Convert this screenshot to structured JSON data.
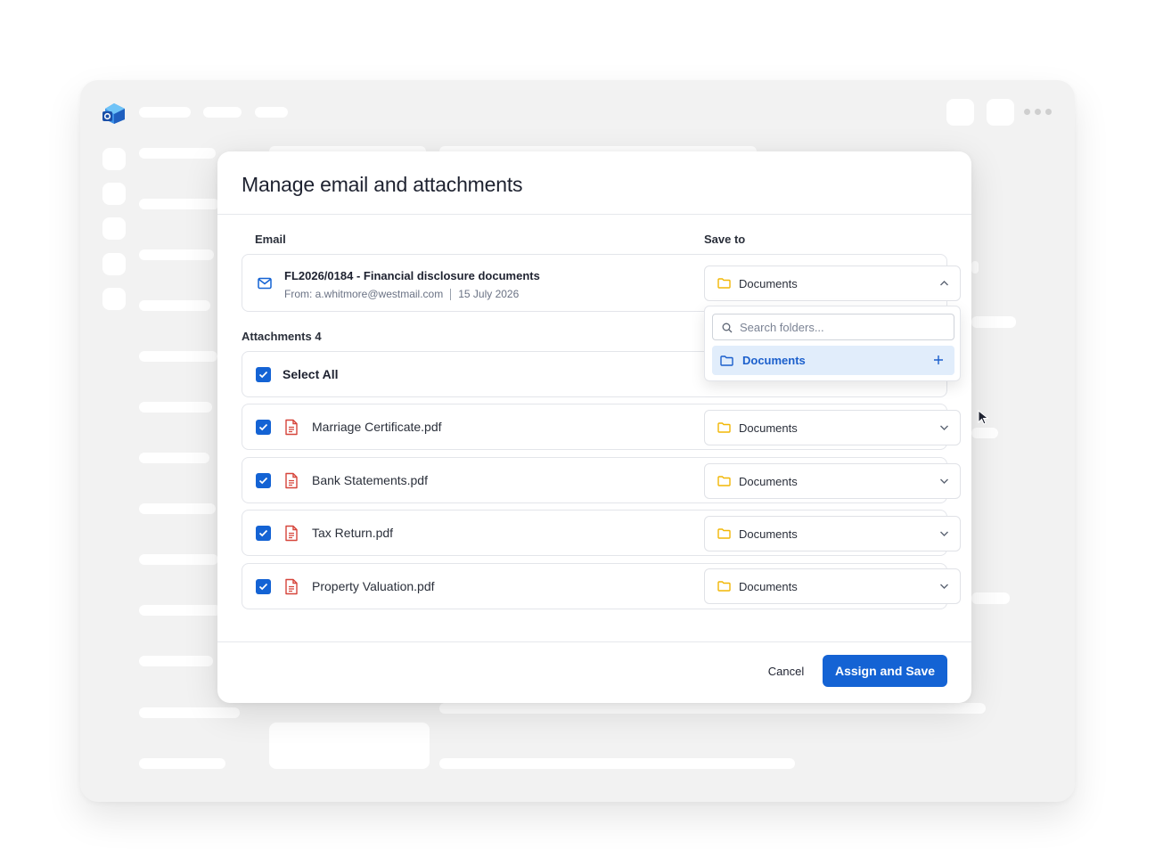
{
  "modal": {
    "title": "Manage email and attachments",
    "email_column_label": "Email",
    "save_to_column_label": "Save to",
    "email": {
      "subject": "FL2026/0184 - Financial disclosure documents",
      "from": "From: a.whitmore@westmail.com",
      "date": "15 July 2026",
      "save_to": "Documents",
      "icon": "mail-icon"
    },
    "attachments_label": "Attachments 4",
    "select_all": {
      "label": "Select All",
      "checked": true
    },
    "attachments": [
      {
        "name": "Marriage Certificate.pdf",
        "save_to": "Documents",
        "checked": true
      },
      {
        "name": "Bank Statements.pdf",
        "save_to": "Documents",
        "checked": true
      },
      {
        "name": "Tax Return.pdf",
        "save_to": "Documents",
        "checked": true
      },
      {
        "name": "Property Valuation.pdf",
        "save_to": "Documents",
        "checked": true
      }
    ],
    "dropdown": {
      "open": true,
      "search_placeholder": "Search folders...",
      "items": [
        {
          "label": "Documents",
          "selected": true
        }
      ]
    },
    "cancel_label": "Cancel",
    "primary_label": "Assign and Save"
  },
  "colors": {
    "accent": "#1463d4",
    "folder": "#f2b705",
    "pdf": "#d6453b",
    "dropdown_highlight": "#e1edfb"
  }
}
